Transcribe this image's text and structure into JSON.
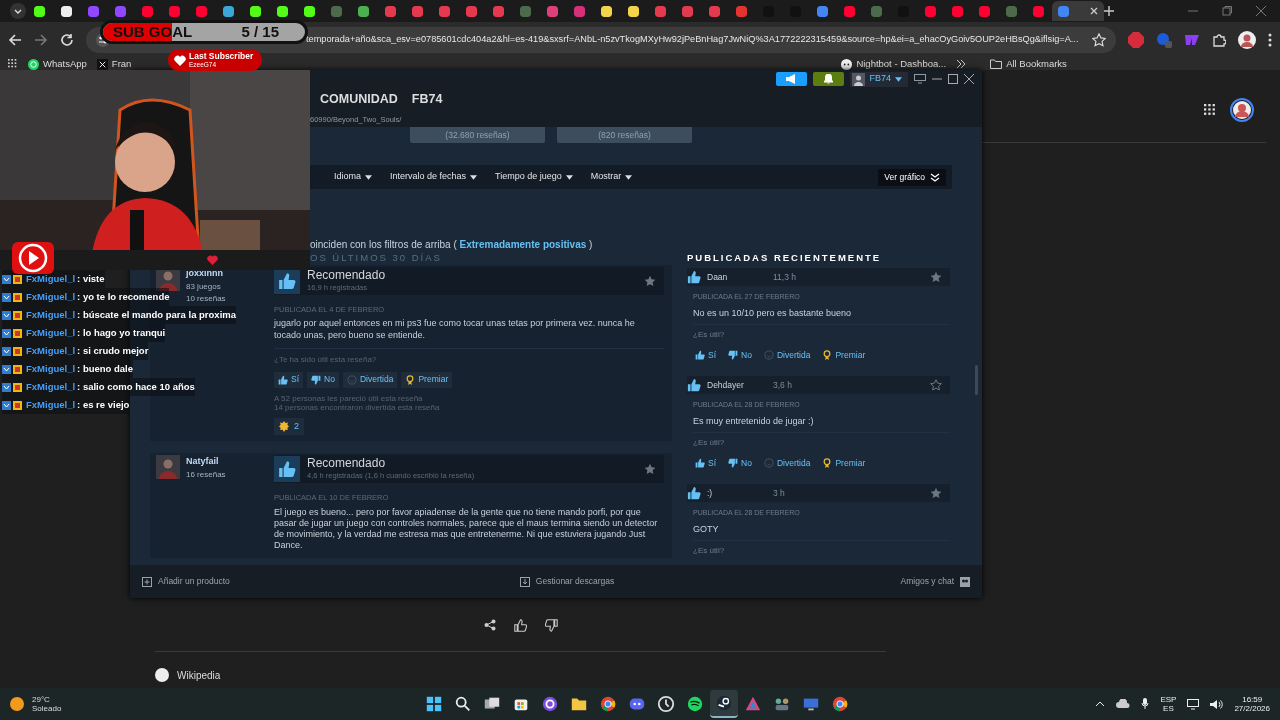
{
  "browser": {
    "tabs": [
      {
        "color": "#53fc18",
        "selected": false
      },
      {
        "color": "#eeeeee",
        "selected": false
      },
      {
        "color": "#9146ff",
        "selected": false
      },
      {
        "color": "#9146ff",
        "selected": false
      },
      {
        "color": "#ff0033",
        "selected": false
      },
      {
        "color": "#ff0033",
        "selected": false
      },
      {
        "color": "#ff0033",
        "selected": false
      },
      {
        "color": "#3aa7d8",
        "selected": false
      },
      {
        "color": "#53fc18",
        "selected": false
      },
      {
        "color": "#53fc18",
        "selected": false
      },
      {
        "color": "#53fc18",
        "selected": false
      },
      {
        "color": "#4c6b4c",
        "selected": false
      },
      {
        "color": "#4caf50",
        "selected": false
      },
      {
        "color": "#e53950",
        "selected": false
      },
      {
        "color": "#e53950",
        "selected": false
      },
      {
        "color": "#e53950",
        "selected": false
      },
      {
        "color": "#e53950",
        "selected": false
      },
      {
        "color": "#e53950",
        "selected": false
      },
      {
        "color": "#4c6b4c",
        "selected": false
      },
      {
        "color": "#e0407a",
        "selected": false
      },
      {
        "color": "#d6307a",
        "selected": false
      },
      {
        "color": "#f3d34a",
        "selected": false
      },
      {
        "color": "#f3d34a",
        "selected": false
      },
      {
        "color": "#e53950",
        "selected": false
      },
      {
        "color": "#e53950",
        "selected": false
      },
      {
        "color": "#e53950",
        "selected": false
      },
      {
        "color": "#e33333",
        "selected": false
      },
      {
        "color": "#111111",
        "selected": false
      },
      {
        "color": "#111111",
        "selected": false
      },
      {
        "color": "#4285f4",
        "selected": false
      },
      {
        "color": "#ff0033",
        "selected": false
      },
      {
        "color": "#4c6b4c",
        "selected": false
      },
      {
        "color": "#111111",
        "selected": false
      },
      {
        "color": "#ff0033",
        "selected": false
      },
      {
        "color": "#ff0033",
        "selected": false
      },
      {
        "color": "#ff0033",
        "selected": false
      },
      {
        "color": "#4c6b4c",
        "selected": false
      },
      {
        "color": "#ff0033",
        "selected": false
      },
      {
        "color": "#4285f4",
        "selected": true
      }
    ],
    "url": "temporada+año&sca_esv=e0785601cdc404a2&hl=es-419&sxsrf=ANbL-n5zvTkogMXyHw92jPeBnHag7JwNiQ%3A1772222315459&source=hp&ei=a_ehacOyGoiv5OUP2eHBsQg&iflsig=A...",
    "bookmarks": [
      {
        "kind": "whatsapp",
        "label": "WhatsApp"
      },
      {
        "kind": "x",
        "label": "Fran"
      },
      {
        "kind": "bot",
        "label": "Nightbot - Dashboa..."
      }
    ],
    "all_bookmarks": "All Bookmarks",
    "result_title": "Wikipedia"
  },
  "stream_overlay": {
    "sub_goal": {
      "label": "SUB GOAL",
      "count": "5 / 15",
      "level": 0.34
    },
    "last_subscriber": {
      "title": "Last Subscriber",
      "name": "EzeeG74"
    },
    "chat": [
      {
        "user": "FxMiguel_l",
        "message": ": viste"
      },
      {
        "user": "FxMiguel_l",
        "message": ": yo te lo recomende"
      },
      {
        "user": "FxMiguel_l",
        "message": ": búscate el mando para la proxima"
      },
      {
        "user": "FxMiguel_l",
        "message": ": lo hago yo tranqui"
      },
      {
        "user": "FxMiguel_l",
        "message": ": si crudo mejor"
      },
      {
        "user": "FxMiguel_l",
        "message": ": bueno dale"
      },
      {
        "user": "FxMiguel_l",
        "message": ": salio como hace 10 años"
      },
      {
        "user": "FxMiguel_l",
        "message": ": es re viejo"
      }
    ]
  },
  "steam": {
    "username": "FB74",
    "nav": [
      "COMUNIDAD",
      "FB74"
    ],
    "url": "60990/Beyond_Two_Souls/",
    "rating_buttons": [
      "(32.680 reseñas)",
      "(820 reseñas)"
    ],
    "filters": [
      "Idioma",
      "Intervalo de fechas",
      "Tiempo de juego",
      "Mostrar"
    ],
    "graph_button": "Ver gráfico",
    "filter_note": {
      "text": "oinciden con los filtros de arriba (",
      "highlight": "Extremadamente positivas",
      "close": ")"
    },
    "section_title": "OS ÚLTIMOS 30 DÍAS",
    "reviews": [
      {
        "author": "joxxinnn",
        "games": "83 juegos",
        "count": "10 reseñas",
        "verdict": "Recomendado",
        "hours": "16,9 h registradas",
        "starred": true,
        "date": "PUBLICADA EL 4 DE FEBRERO",
        "text": "jugarlo por aquel entonces en mi ps3 fue como tocar unas tetas por primera vez. nunca he tocado unas, pero bueno se entiende.",
        "question": "¿Te ha sido útil esta reseña?",
        "actions": [
          {
            "kind": "yes",
            "label": "Sí"
          },
          {
            "kind": "no",
            "label": "No"
          },
          {
            "kind": "funny",
            "label": "Divertida"
          },
          {
            "kind": "award",
            "label": "Premiar"
          }
        ],
        "stats": [
          "A 52 personas les pareció útil esta reseña",
          "14 personas encontraron divertida esta reseña"
        ],
        "awards": "2"
      },
      {
        "author": "Natyfail",
        "count": "16 reseñas",
        "verdict": "Recomendado",
        "hours": "4,6 h registradas (1,6 h cuando escribió la reseña)",
        "starred": true,
        "date": "PUBLICADA EL 10 DE FEBRERO",
        "text": "El juego es bueno... pero por favor apiadense de la gente que no tiene mando porfi, por que pasar de jugar un juego con controles normales, parece que el maus termina siendo un detector de movimiento, y la verdad me estresa mas que entretenerme. Ni que estuviera jugando Just Dance."
      }
    ],
    "recent_title": "PUBLICADAS RECIENTEMENTE",
    "recent": [
      {
        "author": "Daan",
        "hours": "11,3 h",
        "starred": true,
        "date": "PUBLICADA EL 27 DE FEBRERO",
        "text": "No es un 10/10 pero es bastante bueno",
        "question": "¿Es útil?",
        "actions": [
          {
            "kind": "yes",
            "label": "Sí"
          },
          {
            "kind": "no",
            "label": "No"
          },
          {
            "kind": "funny",
            "label": "Divertida"
          },
          {
            "kind": "award",
            "label": "Premiar"
          }
        ]
      },
      {
        "author": "Dehdayer",
        "hours": "3,6 h",
        "starred": false,
        "date": "PUBLICADA EL 28 DE FEBRERO",
        "text": "Es muy entretenido de jugar :)",
        "question": "¿Es útil?",
        "actions": [
          {
            "kind": "yes",
            "label": "Sí"
          },
          {
            "kind": "no",
            "label": "No"
          },
          {
            "kind": "funny",
            "label": "Divertida"
          },
          {
            "kind": "award",
            "label": "Premiar"
          }
        ]
      },
      {
        "author": ":)",
        "hours": "3 h",
        "starred": true,
        "date": "PUBLICADA EL 28 DE FEBRERO",
        "text": "GOTY",
        "question": "¿Es útil?"
      }
    ],
    "footer": [
      "Añadir un producto",
      "Gestionar descargas",
      "Amigos y chat"
    ]
  },
  "taskbar": {
    "weather": {
      "temp": "29°C",
      "desc": "Soleado"
    },
    "apps": [
      {
        "kind": "start",
        "selected": false
      },
      {
        "kind": "search",
        "selected": false
      },
      {
        "kind": "taskview",
        "selected": false
      },
      {
        "kind": "store",
        "selected": false
      },
      {
        "kind": "ring",
        "selected": false
      },
      {
        "kind": "folder",
        "selected": false
      },
      {
        "kind": "chrome",
        "selected": false
      },
      {
        "kind": "discord",
        "selected": false
      },
      {
        "kind": "clock",
        "selected": false
      },
      {
        "kind": "spotify",
        "selected": false
      },
      {
        "kind": "steam",
        "selected": true
      },
      {
        "kind": "triangle",
        "selected": false
      },
      {
        "kind": "group",
        "selected": false
      },
      {
        "kind": "monitor",
        "selected": false
      },
      {
        "kind": "chrome",
        "selected": false
      }
    ],
    "language": "ESP",
    "layout": "ES",
    "time": "16:59",
    "date": "27/2/2026"
  }
}
